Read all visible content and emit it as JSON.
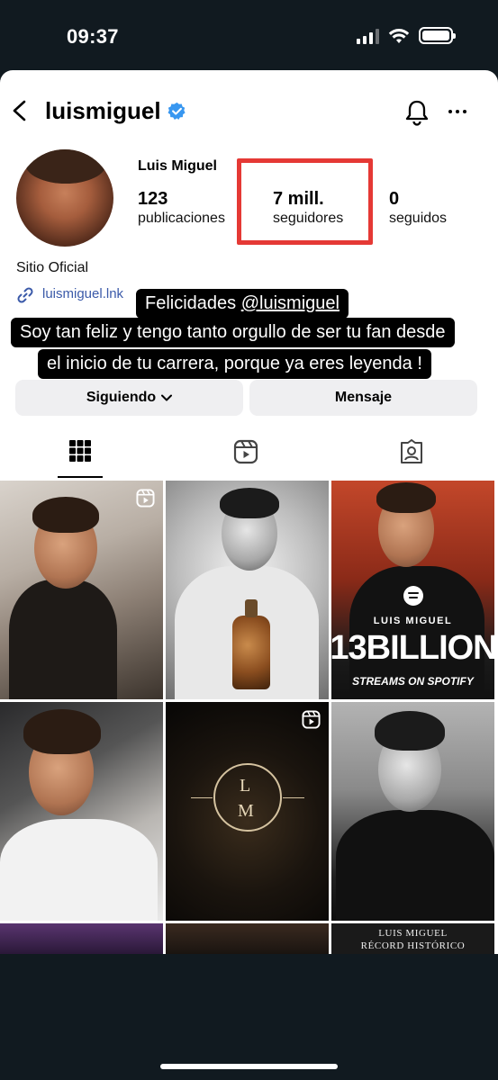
{
  "status_bar": {
    "time": "09:37"
  },
  "profile": {
    "username": "luismiguel",
    "display_name": "Luis Miguel",
    "stats": {
      "posts": {
        "value": "123",
        "label": "publicaciones"
      },
      "followers": {
        "value": "7 mill.",
        "label": "seguidores"
      },
      "following": {
        "value": "0",
        "label": "seguidos"
      }
    },
    "bio": "Sitio Oficial",
    "link": "luismiguel.lnk"
  },
  "story_caption": {
    "line1_prefix": "Felicidades ",
    "line1_mention": "@luismiguel",
    "line2": "Soy tan feliz y tengo tanto orgullo de ser tu fan desde",
    "line3": "el inicio de tu carrera, porque ya eres leyenda !"
  },
  "actions": {
    "follow_label": "Siguiendo",
    "message_label": "Mensaje"
  },
  "tabs": [
    {
      "icon": "grid-icon",
      "active": true
    },
    {
      "icon": "reels-icon",
      "active": false
    },
    {
      "icon": "tagged-icon",
      "active": false
    }
  ],
  "posts": {
    "post3": {
      "artist": "LUIS MIGUEL",
      "headline": "13BILLION",
      "subline": "STREAMS ON SPOTIFY"
    },
    "post5": {
      "monogram_top": "L",
      "monogram_bottom": "M"
    },
    "post9": {
      "line1": "LUIS MIGUEL",
      "line2": "RÉCORD HISTÓRICO"
    }
  },
  "colors": {
    "highlight": "#e53935",
    "verified": "#3897f0",
    "link": "#3b5aa9"
  }
}
